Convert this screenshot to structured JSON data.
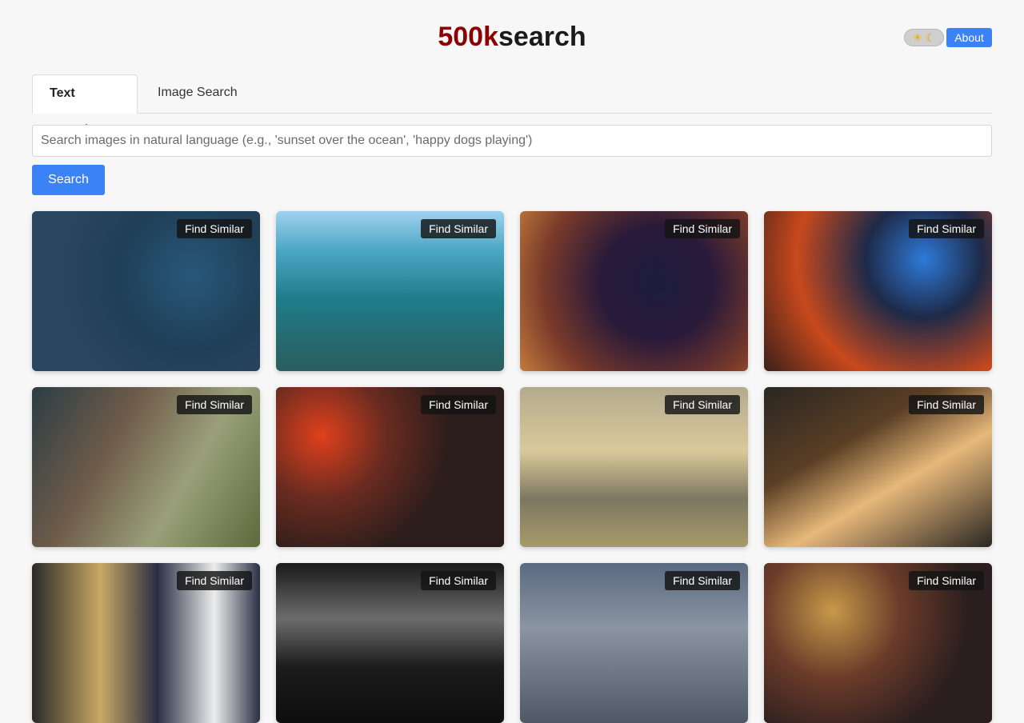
{
  "header": {
    "logo_brand": "500k",
    "logo_rest": "search",
    "theme_sun_icon": "☀",
    "theme_moon_icon": "☾",
    "about_label": "About"
  },
  "tabs": [
    {
      "label": "Text Search",
      "active": true
    },
    {
      "label": "Image Search",
      "active": false
    }
  ],
  "search": {
    "placeholder": "Search images in natural language (e.g., 'sunset over the ocean', 'happy dogs playing')",
    "value": "",
    "button_label": "Search"
  },
  "results": {
    "find_similar_label": "Find Similar",
    "columns": 4,
    "count": 12
  },
  "colors": {
    "accent": "#3b82f6",
    "brand": "#8b0000",
    "background": "#f7f7f7"
  }
}
